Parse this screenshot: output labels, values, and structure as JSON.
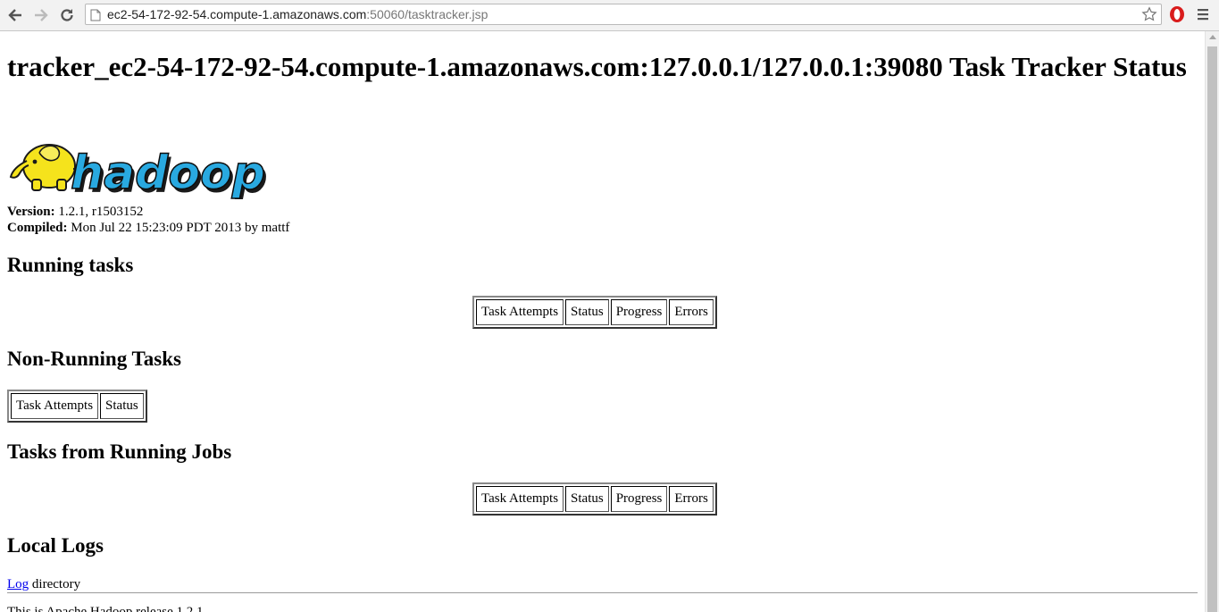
{
  "browser": {
    "url_host": "ec2-54-172-92-54.compute-1.amazonaws.com",
    "url_rest": ":50060/tasktracker.jsp"
  },
  "page": {
    "title": "tracker_ec2-54-172-92-54.compute-1.amazonaws.com:127.0.0.1/127.0.0.1:39080 Task Tracker Status",
    "logo_text": "hadoop",
    "version_label": "Version:",
    "version_value": "1.2.1, r1503152",
    "compiled_label": "Compiled:",
    "compiled_value": "Mon Jul 22 15:23:09 PDT 2013 by mattf",
    "sections": {
      "running_tasks": {
        "heading": "Running tasks",
        "columns": [
          "Task Attempts",
          "Status",
          "Progress",
          "Errors"
        ]
      },
      "non_running_tasks": {
        "heading": "Non-Running Tasks",
        "columns": [
          "Task Attempts",
          "Status"
        ]
      },
      "tasks_running_jobs": {
        "heading": "Tasks from Running Jobs",
        "columns": [
          "Task Attempts",
          "Status",
          "Progress",
          "Errors"
        ]
      },
      "local_logs": {
        "heading": "Local Logs",
        "link": "Log",
        "link_suffix": " directory"
      }
    },
    "footer": "This is Apache Hadoop release 1.2.1"
  }
}
